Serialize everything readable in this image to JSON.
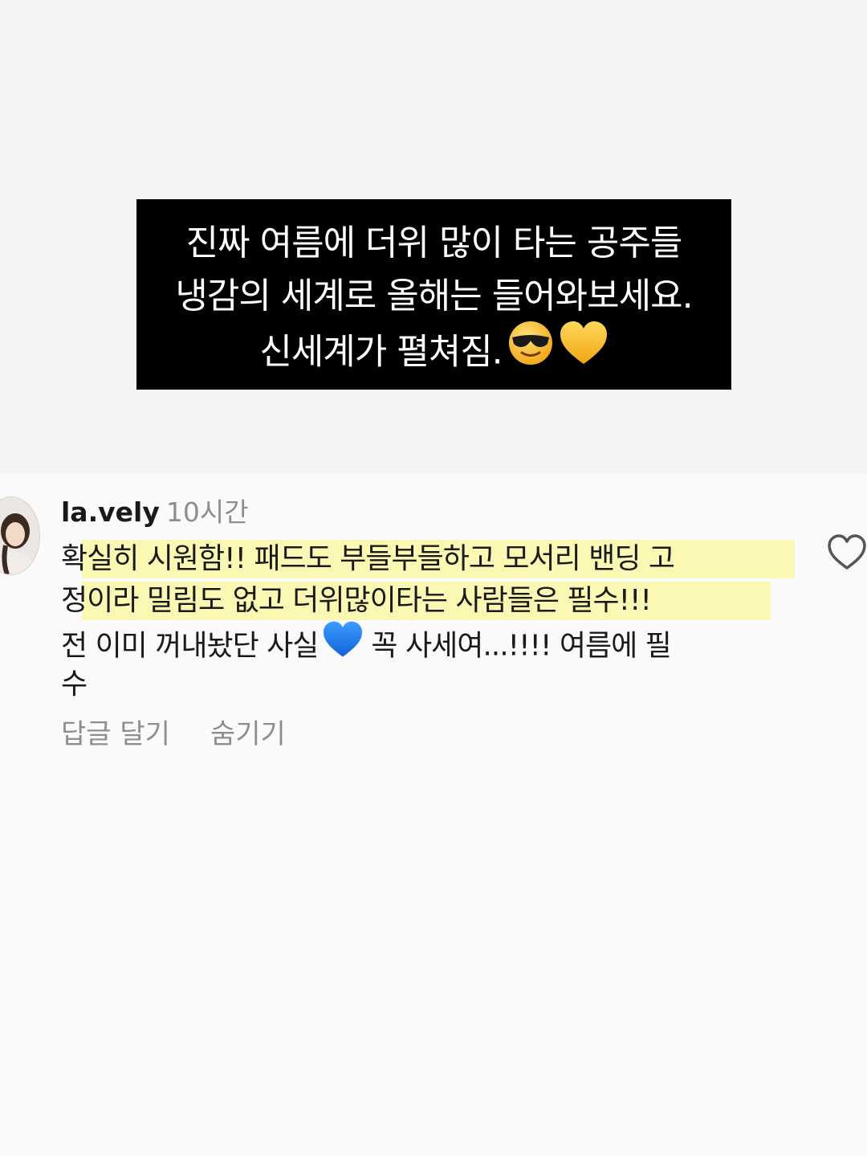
{
  "caption": {
    "lines": [
      "진짜 여름에 더위 많이 타는 공주들",
      "냉감의 세계로 올해는 들어와보세요.",
      "신세계가 펼쳐짐."
    ],
    "emoji_1": "sunglasses-smiley",
    "emoji_2": "yellow-heart"
  },
  "comment": {
    "username": "la.vely",
    "time": "10시간",
    "lines": [
      "확실히 시원함!! 패드도 부들부들하고 모서리 밴딩 고",
      "정이라 밀림도 없고 더위많이타는 사람들은 필수!!!",
      "전 이미 꺼내놨단 사실",
      "꼭 사세여...!!!! 여름에 필",
      "수"
    ],
    "reply_label": "답글 달기",
    "hide_label": "숨기기",
    "highlight_color": "#faf7a6"
  }
}
